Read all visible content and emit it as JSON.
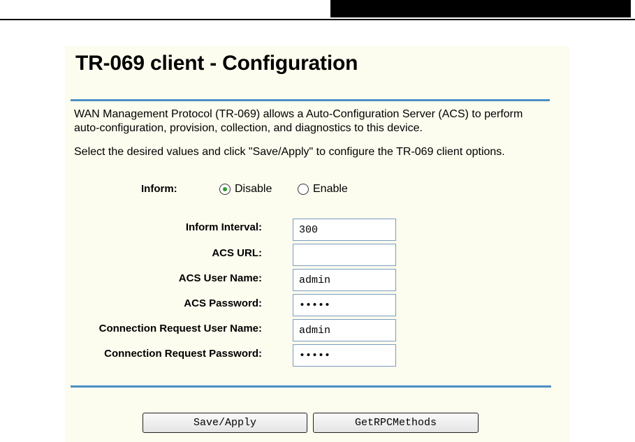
{
  "page": {
    "title": "TR-069 client - Configuration",
    "description_1": "WAN Management Protocol (TR-069) allows a Auto-Configuration Server (ACS) to perform auto-configuration, provision, collection, and diagnostics to this device.",
    "description_2": "Select the desired values and click \"Save/Apply\" to configure the TR-069 client options."
  },
  "inform": {
    "label": "Inform:",
    "options": [
      {
        "label": "Disable",
        "selected": true
      },
      {
        "label": "Enable",
        "selected": false
      }
    ]
  },
  "fields": [
    {
      "label": "Inform Interval:",
      "value": "300",
      "type": "text"
    },
    {
      "label": "ACS URL:",
      "value": "",
      "type": "text"
    },
    {
      "label": "ACS User Name:",
      "value": "admin",
      "type": "text"
    },
    {
      "label": "ACS Password:",
      "value": "•••••",
      "type": "password"
    },
    {
      "label": "Connection Request User Name:",
      "value": "admin",
      "type": "text"
    },
    {
      "label": "Connection Request Password:",
      "value": "•••••",
      "type": "password"
    }
  ],
  "buttons": {
    "save": "Save/Apply",
    "rpc": "GetRPCMethods"
  },
  "colors": {
    "panel_background": "#fcfcef",
    "rule": "#4a8fc4",
    "input_border": "#7a9cc0",
    "radio_selected": "#2c9b2c"
  }
}
